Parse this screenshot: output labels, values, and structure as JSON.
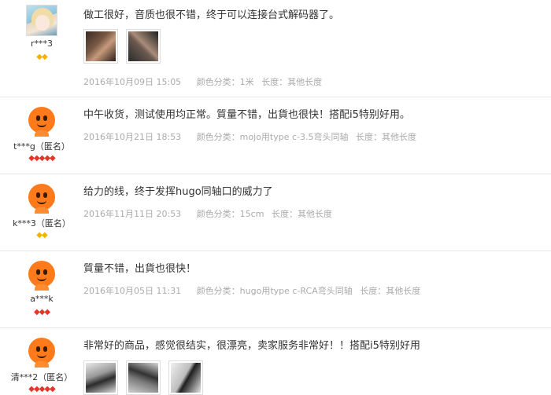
{
  "reviews": [
    {
      "nick": "r***3",
      "avatar": "user-photo",
      "level": "◆◆",
      "level_color": "#f2b200",
      "content": "做工很好，音质也很不错，终于可以连接台式解码器了。",
      "date": "2016年10月09日 15:05",
      "color_class": "颜色分类：1米",
      "length": "长度：其他长度",
      "photos": 2
    },
    {
      "nick": "t***g（匿名）",
      "avatar": "taobao-default",
      "level": "◆◆◆◆◆",
      "level_color": "#e8352a",
      "content": "中午收货，测试使用均正常。質量不错，出貨也很快！搭配i5特别好用。",
      "date": "2016年10月21日 18:53",
      "color_class": "颜色分类：mojo用type c-3.5弯头同轴",
      "length": "长度：其他长度"
    },
    {
      "nick": "k***3（匿名）",
      "avatar": "taobao-default",
      "level": "◆◆",
      "level_color": "#f2b200",
      "content": "给力的线，终于发挥hugo同轴口的威力了",
      "date": "2016年11月11日 20:53",
      "color_class": "颜色分类：15cm",
      "length": "长度：其他长度"
    },
    {
      "nick": "a***k",
      "avatar": "taobao-default",
      "level": "◆◆◆",
      "level_color": "#e8352a",
      "content": "質量不错，出貨也很快！",
      "date": "2016年10月05日 11:31",
      "color_class": "颜色分类：hugo用type c-RCA弯头同轴",
      "length": "长度：其他长度"
    },
    {
      "nick": "清***2（匿名）",
      "avatar": "taobao-default",
      "level": "◆◆◆◆◆",
      "level_color": "#e8352a",
      "content": "非常好的商品，感觉很结实，很漂亮，卖家服务非常好！！搭配i5特别好用",
      "photos": 3
    }
  ]
}
